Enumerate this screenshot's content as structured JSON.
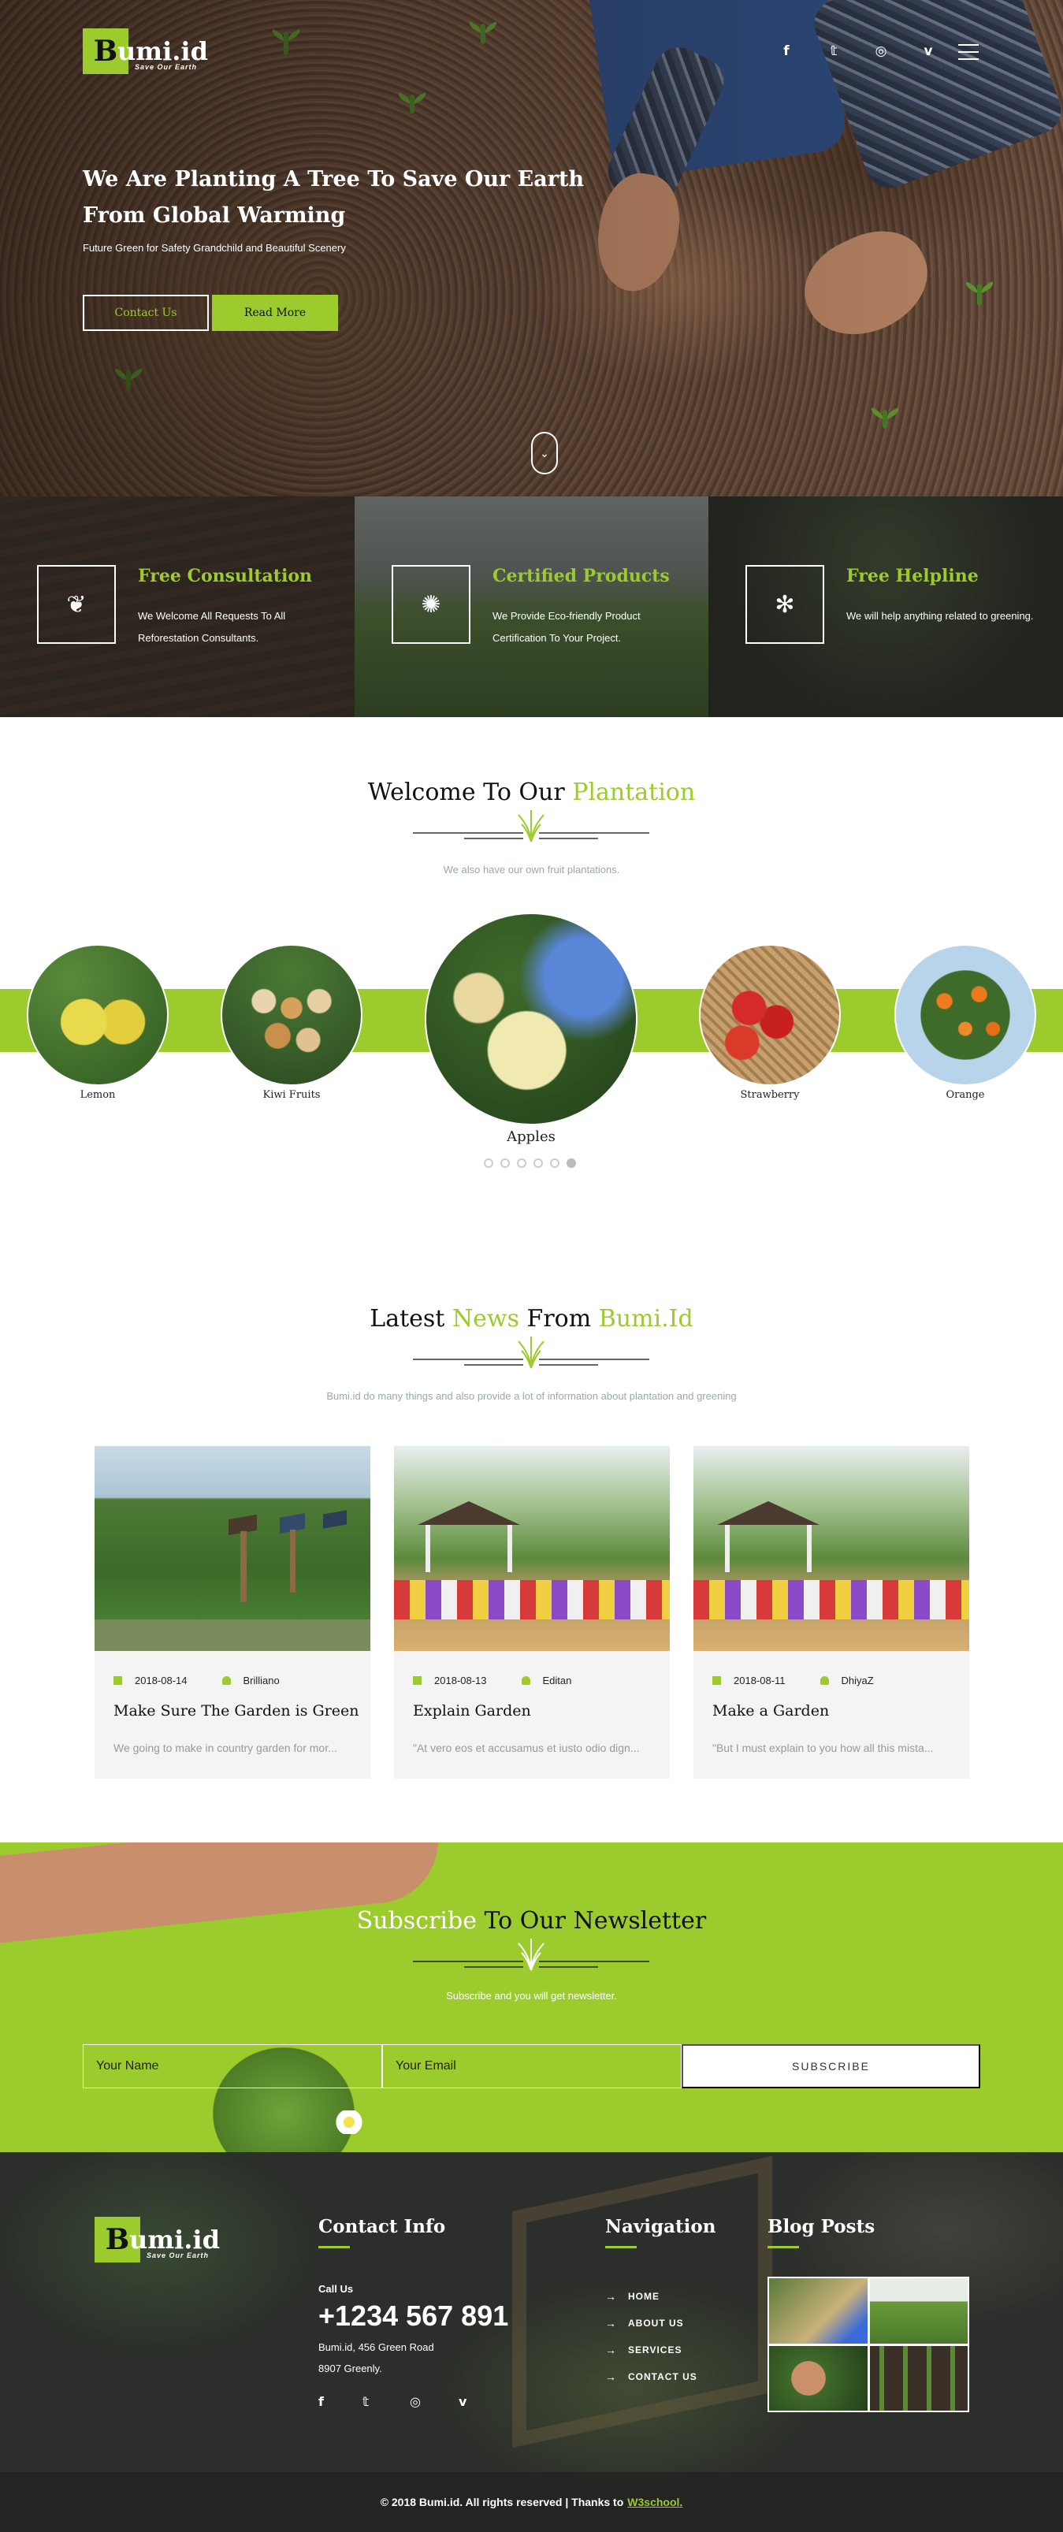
{
  "brand": {
    "logo_letter": "B",
    "logo_rest": "umi.id",
    "tagline": "Save Our Earth"
  },
  "header": {
    "social": [
      {
        "icon": "facebook-icon",
        "glyph": "f"
      },
      {
        "icon": "twitter-icon",
        "glyph": "𝕥"
      },
      {
        "icon": "dribbble-icon",
        "glyph": "◎"
      },
      {
        "icon": "vimeo-icon",
        "glyph": "v"
      }
    ]
  },
  "hero": {
    "title": "We Are Planting A Tree To Save Our Earth From Global Warming",
    "subtitle": "Future Green for Safety Grandchild and Beautiful Scenery",
    "contact_label": "Contact Us",
    "readmore_label": "Read More",
    "scroll_glyph": "⌄"
  },
  "features": [
    {
      "icon": "leaf-icon",
      "glyph": "❦",
      "title": "Free Consultation",
      "text": "We Welcome All Requests To All Reforestation Consultants."
    },
    {
      "icon": "flower-icon",
      "glyph": "✺",
      "title": "Certified Products",
      "text": "We Provide Eco-friendly Product Certification To Your Project."
    },
    {
      "icon": "sprout-icon",
      "glyph": "✻",
      "title": "Free Helpline",
      "text": "We will help anything related to greening."
    }
  ],
  "plantation": {
    "title_a": "Welcome To Our ",
    "title_b": "Plantation",
    "subtitle": "We also have our own fruit plantations.",
    "fruits": [
      "Lemon",
      "Kiwi Fruits",
      "Apples",
      "Strawberry",
      "Orange"
    ]
  },
  "news": {
    "title_a": "Latest ",
    "title_b": "News",
    "title_c": " From ",
    "title_d": "Bumi.Id",
    "subtitle": "Bumi.id do many things and also provide a lot of information about plantation and greening",
    "posts": [
      {
        "date": "2018-08-14",
        "author": "Brilliano",
        "title": "Make Sure The Garden is Green",
        "excerpt": "We going to make in country garden for mor..."
      },
      {
        "date": "2018-08-13",
        "author": "Editan",
        "title": "Explain Garden",
        "excerpt": "\"At vero eos et accusamus et iusto odio dign..."
      },
      {
        "date": "2018-08-11",
        "author": "DhiyaZ",
        "title": "Make a Garden",
        "excerpt": "\"But I must explain to you how all this mista..."
      }
    ]
  },
  "newsletter": {
    "title_a": "Subscribe",
    "title_b": " To Our Newsletter",
    "subtitle": "Subscribe and you will get newsletter.",
    "name_placeholder": "Your Name",
    "email_placeholder": "Your Email",
    "button": "SUBSCRIBE"
  },
  "footer": {
    "contact_heading": "Contact Info",
    "call_label": "Call Us",
    "phone": "+1234 567 891",
    "address1": "Bumi.id, 456 Green Road",
    "address2": "8907 Greenly.",
    "nav_heading": "Navigation",
    "nav": [
      "HOME",
      "ABOUT US",
      "SERVICES",
      "CONTACT US"
    ],
    "blog_heading": "Blog Posts",
    "copyright": "© 2018 Bumi.id. All rights reserved | Thanks to",
    "credit": "W3school."
  },
  "colors": {
    "accent": "#9bcb2c",
    "footer_bg": "#2b2e2a"
  }
}
